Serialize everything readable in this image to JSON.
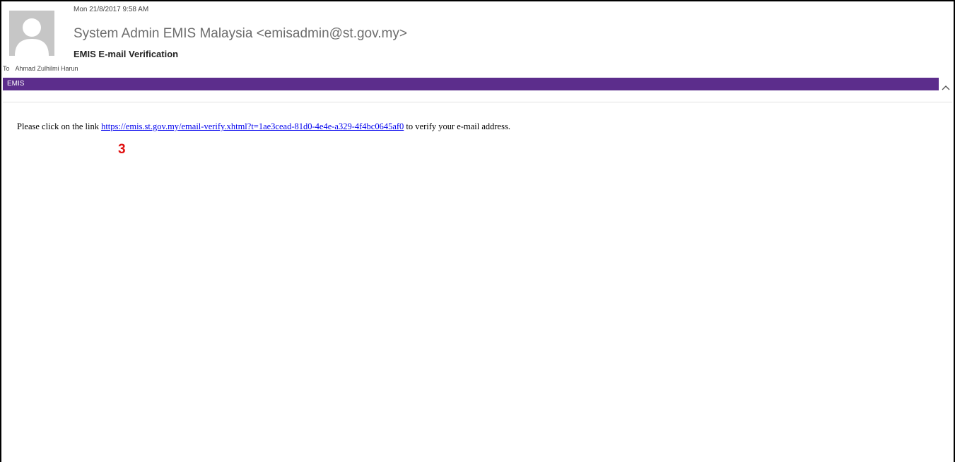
{
  "message": {
    "datetime": "Mon 21/8/2017 9:58 AM",
    "sender": "System Admin EMIS Malaysia <emisadmin@st.gov.my>",
    "subject": "EMIS E-mail Verification",
    "to_label": "To",
    "recipient": "Ahmad Zulhilmi Harun",
    "category": "EMIS",
    "category_color": "#5c2d8c"
  },
  "body": {
    "prefix": "Please click on the link ",
    "link": "https://emis.st.gov.my/email-verify.xhtml?t=1ae3cead-81d0-4e4e-a329-4f4bc0645af0",
    "suffix": " to verify your e-mail address."
  },
  "annotation": {
    "step": "3",
    "color": "#e01010"
  },
  "icons": {
    "avatar": "person-silhouette-icon",
    "collapse": "chevron-up-icon"
  }
}
